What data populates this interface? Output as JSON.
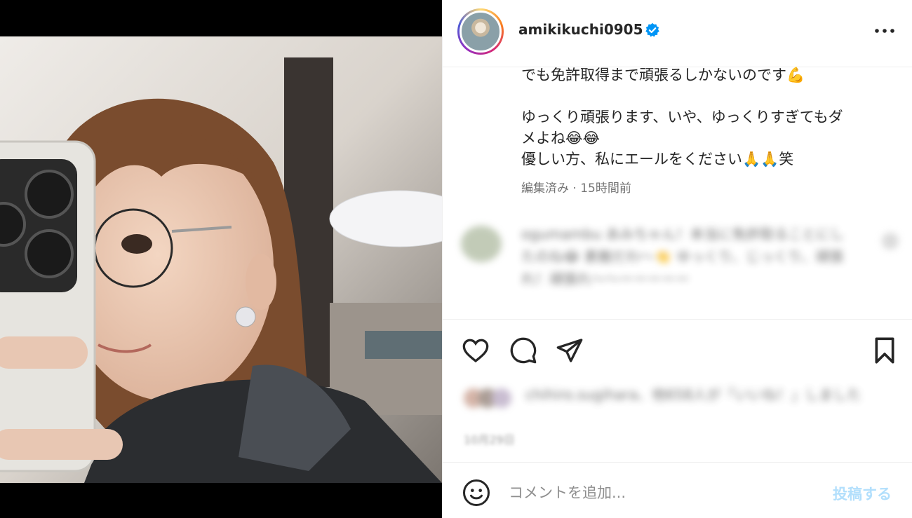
{
  "post": {
    "username": "amikikuchi0905",
    "caption_lines": [
      "でも免許取得まで頑張るしかないのです💪",
      "",
      "ゆっくり頑張ります、いや、ゆっくりすぎてもダ",
      "メよね😂😂",
      "優しい方、私にエールをください🙏🙏笑"
    ],
    "meta": "編集済み · 15時間前"
  },
  "comment": {
    "text": "ogumambu あみちゃん！本当に免許取ることにしたのね😂 素敵だわ～👏 ゆっくり、じっくり、頑張れ！頑張れ〜〜ーーーーー"
  },
  "likes": {
    "text": "chihiro.sugihara、他658人が「いいね！」しました",
    "date": "10月29日"
  },
  "composer": {
    "placeholder": "コメントを追加...",
    "post_label": "投稿する"
  },
  "colors": {
    "verified": "#0095f6",
    "post_disabled": "#b2dffc"
  },
  "icons": [
    "verified-badge-icon",
    "more-options-icon",
    "heart-icon",
    "comment-icon",
    "share-icon",
    "bookmark-icon",
    "emoji-icon"
  ]
}
